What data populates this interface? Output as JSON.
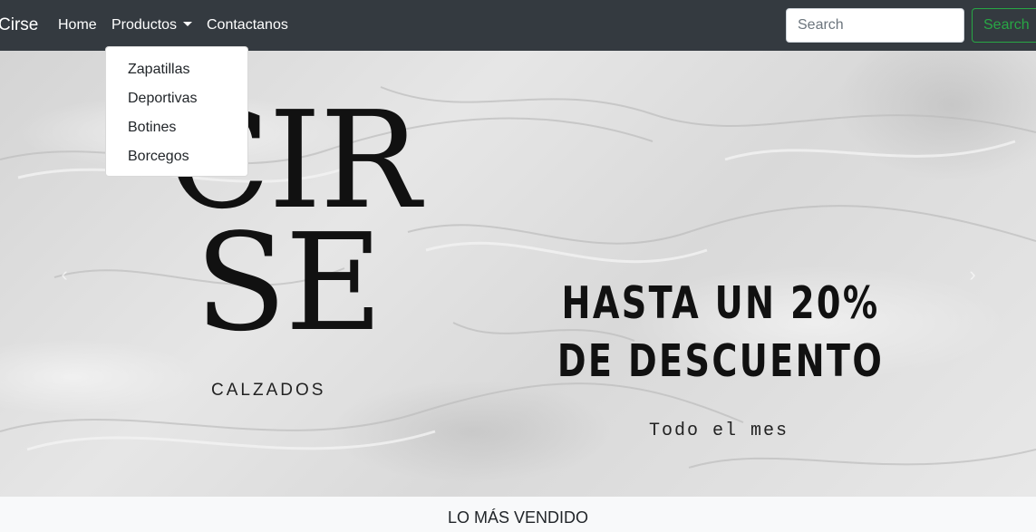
{
  "navbar": {
    "brand": "Cirse",
    "links": [
      {
        "label": "Home"
      },
      {
        "label": "Productos"
      },
      {
        "label": "Contactanos"
      }
    ],
    "search": {
      "placeholder": "Search",
      "button_label": "Search"
    }
  },
  "dropdown": {
    "items": [
      {
        "label": "Zapatillas"
      },
      {
        "label": "Deportivas"
      },
      {
        "label": "Botines"
      },
      {
        "label": "Borcegos"
      }
    ]
  },
  "carousel": {
    "logo_line1": "CIR",
    "logo_line2": "SE",
    "logo_subtitle": "CALZADOS",
    "promo_line1": "HASTA UN 20%",
    "promo_line2": "DE DESCUENTO",
    "promo_sub": "Todo el mes",
    "prev_icon": "‹",
    "next_icon": "›"
  },
  "section": {
    "title": "LO MÁS VENDIDO"
  },
  "colors": {
    "navbar_bg": "#343a40",
    "success": "#28a745",
    "section_bg": "#f8f9fa"
  }
}
